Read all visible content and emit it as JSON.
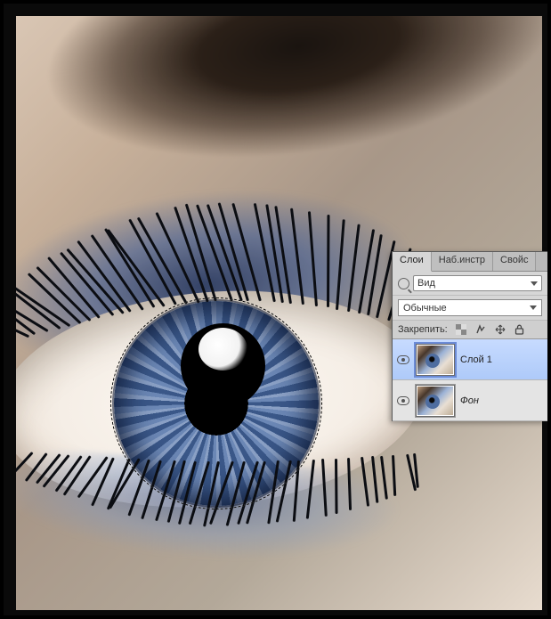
{
  "panel": {
    "tabs": [
      {
        "label": "Слои",
        "active": true
      },
      {
        "label": "Наб.инстр",
        "active": false
      },
      {
        "label": "Свойс",
        "active": false
      }
    ],
    "filter_kind": "Вид",
    "blend_mode": "Обычные",
    "lock_label": "Закрепить:"
  },
  "layers": [
    {
      "name": "Слой 1",
      "visible": true,
      "selected": true,
      "italic": false
    },
    {
      "name": "Фон",
      "visible": true,
      "selected": false,
      "italic": true
    }
  ]
}
